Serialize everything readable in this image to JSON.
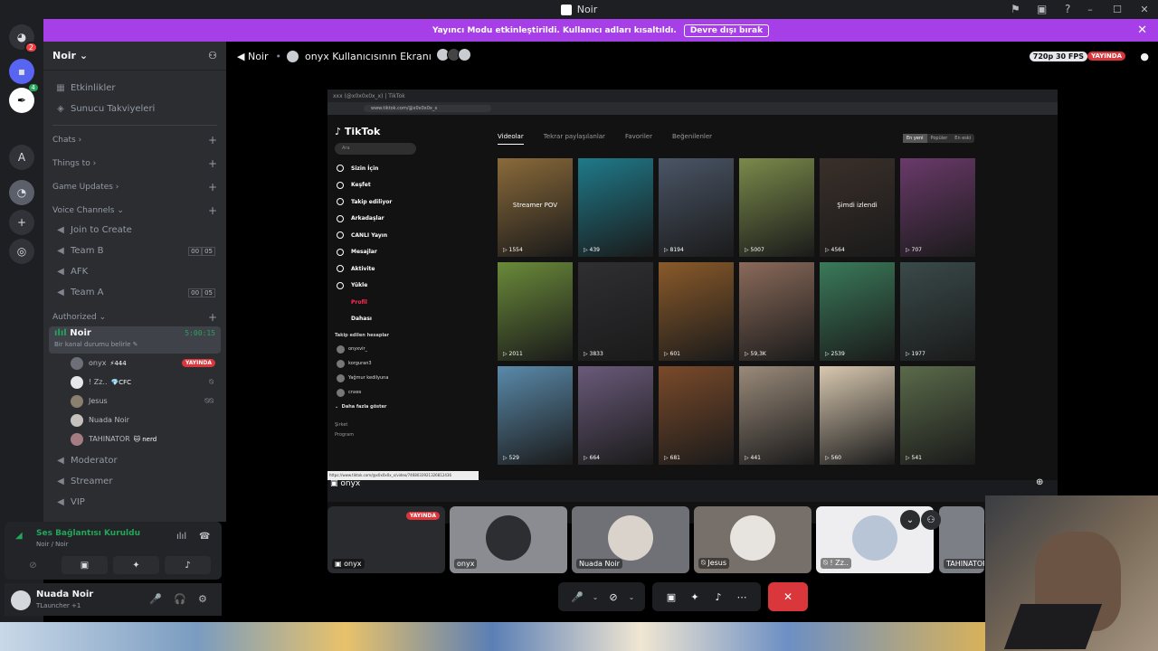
{
  "window": {
    "title": "Noir",
    "controls": [
      "–",
      "☐",
      "✕"
    ]
  },
  "banner": {
    "text": "Yayıncı Modu etkinleştirildi. Kullanıcı adları kısaltıldı.",
    "button": "Devre dışı bırak",
    "close": "✕"
  },
  "servers": {
    "badge": "2",
    "new_badge": "4",
    "letter": "A"
  },
  "sidebar": {
    "server_name": "Noir",
    "top_items": [
      {
        "label": "Etkinlikler"
      },
      {
        "label": "Sunucu Takviyeleri"
      }
    ],
    "categories": {
      "chats": "Chats",
      "things": "Things to",
      "game_updates": "Game Updates",
      "voice": "Voice Channels",
      "authorized": "Authorized"
    },
    "voice_channels": [
      {
        "label": "Join to Create",
        "a": "",
        "b": ""
      },
      {
        "label": "Team B",
        "a": "00",
        "b": "05"
      },
      {
        "label": "AFK",
        "a": "",
        "b": ""
      },
      {
        "label": "Team A",
        "a": "00",
        "b": "05"
      }
    ],
    "active_channel": {
      "name": "Noir",
      "status": "Bir kanal durumu belirle",
      "timer": "5:00:15"
    },
    "voice_users": [
      {
        "name": "onyx",
        "tag": "⚡444",
        "live": "YAYINDA"
      },
      {
        "name": "! Zz..",
        "tag": "💎CFC",
        "live": ""
      },
      {
        "name": "Jesus",
        "tag": "",
        "live": ""
      },
      {
        "name": "Nuada Noir",
        "tag": "",
        "live": ""
      },
      {
        "name": "TAHINATOR",
        "tag": "🐱 nerd",
        "live": ""
      }
    ],
    "other_channels": [
      {
        "label": "Moderator"
      },
      {
        "label": "Streamer"
      },
      {
        "label": "VIP"
      }
    ]
  },
  "voice_panel": {
    "title": "Ses Bağlantısı Kuruldu",
    "subtitle": "Noir / Noir"
  },
  "user_panel": {
    "name": "Nuada Noir",
    "status": "TLauncher +1"
  },
  "call_header": {
    "channel": "Noir",
    "screen": "onyx Kullanıcısının Ekranı",
    "quality": "720p 30 FPS",
    "live": "YAYINDA"
  },
  "stream": {
    "tab": "xxx (@x0x0x0x_x) | TikTok",
    "url": "www.tiktok.com/@x0x0x0x_x",
    "tiktok_logo": "♪ TikTok",
    "search_placeholder": "Ara",
    "nav": [
      {
        "label": "Sizin İçin"
      },
      {
        "label": "Keşfet"
      },
      {
        "label": "Takip ediliyor"
      },
      {
        "label": "Arkadaşlar"
      },
      {
        "label": "CANLI Yayın"
      },
      {
        "label": "Mesajlar"
      },
      {
        "label": "Aktivite"
      },
      {
        "label": "Yükle"
      },
      {
        "label": "Profil"
      },
      {
        "label": "Dahası"
      }
    ],
    "following_title": "Takip edilen hesaplar",
    "following": [
      {
        "label": "onyxvir_"
      },
      {
        "label": "korguran3"
      },
      {
        "label": "Yağmur kedilyuna"
      },
      {
        "label": "cnxes"
      }
    ],
    "show_more": "Daha fazla göster",
    "footer": [
      "Şirket",
      "Program"
    ],
    "tabs": [
      "Videolar",
      "Tekrar paylaşılanlar",
      "Favoriler",
      "Beğenilenler"
    ],
    "sort": [
      "En yeni",
      "Popüler",
      "En eski"
    ],
    "videos": [
      {
        "count": "1554",
        "caption": "Streamer POV",
        "color": "#8a6a3a"
      },
      {
        "count": "439",
        "caption": "",
        "color": "#1f7a8a"
      },
      {
        "count": "8194",
        "caption": "",
        "color": "#4a5566"
      },
      {
        "count": "5007",
        "caption": "",
        "color": "#7a8a4a"
      },
      {
        "count": "4564",
        "caption": "Şimdi izlendi",
        "color": "#3a2f2a"
      },
      {
        "count": "707",
        "caption": "",
        "color": "#6a3a6a"
      },
      {
        "count": "2011",
        "caption": "",
        "color": "#6a8a3a"
      },
      {
        "count": "3833",
        "caption": "",
        "color": "#2f2f33"
      },
      {
        "count": "601",
        "caption": "",
        "color": "#8a5a2a"
      },
      {
        "count": "59,3K",
        "caption": "",
        "color": "#8a6a5a"
      },
      {
        "count": "2539",
        "caption": "",
        "color": "#3a7a5a"
      },
      {
        "count": "1977",
        "caption": "",
        "color": "#3a4a4a"
      },
      {
        "count": "529",
        "caption": "",
        "color": "#5a8aaa"
      },
      {
        "count": "664",
        "caption": "",
        "color": "#6a5a7a"
      },
      {
        "count": "681",
        "caption": "",
        "color": "#7a4a2a"
      },
      {
        "count": "441",
        "caption": "",
        "color": "#9a8a7a"
      },
      {
        "count": "560",
        "caption": "",
        "color": "#d8c8b0"
      },
      {
        "count": "541",
        "caption": "",
        "color": "#5a6a4a"
      }
    ],
    "tooltip": "https://www.tiktok.com/@x0x0x0x_x/video/7468033921326812436",
    "hover_label": "onyx"
  },
  "participants": [
    {
      "name": "onyx",
      "live": "YAYINDA"
    },
    {
      "name": "onyx",
      "live": ""
    },
    {
      "name": "Nuada Noir",
      "live": ""
    },
    {
      "name": "Jesus",
      "live": ""
    },
    {
      "name": "! Zz..",
      "live": ""
    },
    {
      "name": "TAHINATOR",
      "live": ""
    }
  ],
  "icons": {
    "mic": "🎤",
    "headphones": "🎧",
    "gear": "⚙"
  }
}
